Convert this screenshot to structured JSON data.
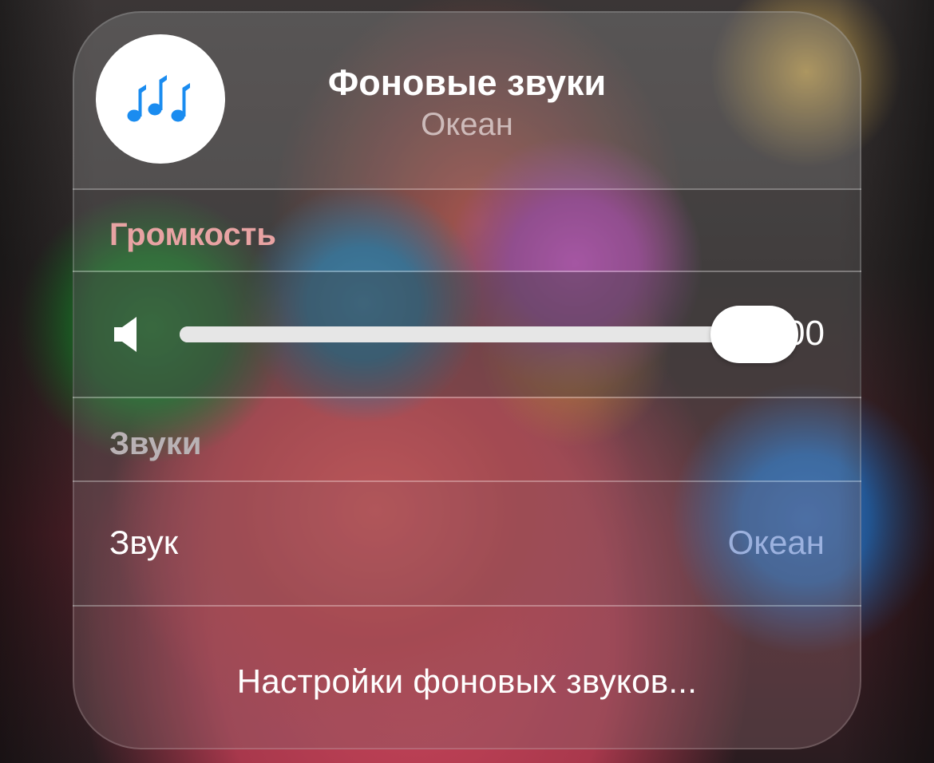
{
  "header": {
    "title": "Фоновые звуки",
    "subtitle": "Океан",
    "icon": "music-notes-icon"
  },
  "volume": {
    "section_label": "Громкость",
    "value_text": "100",
    "level_percent": 100,
    "icon": "speaker-icon"
  },
  "sounds": {
    "section_label": "Звуки",
    "row_label": "Звук",
    "row_value": "Океан"
  },
  "settings_link": "Настройки фоновых звуков...",
  "colors": {
    "accent_blue": "#1a8cf0",
    "section_label_volume": "#e8a3a3",
    "section_label_sounds": "#b9b2b5",
    "sound_value": "#aabee8"
  }
}
